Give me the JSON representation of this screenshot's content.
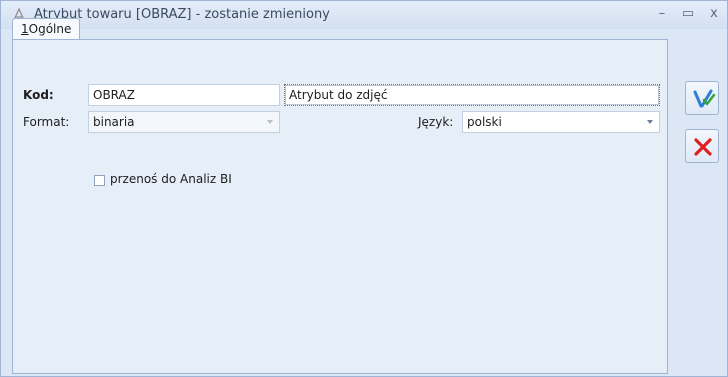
{
  "window": {
    "title": "Atrybut towaru [OBRAZ] - zostanie zmieniony",
    "controls": {
      "minimize": "–",
      "maximize": "▭",
      "close": "x"
    }
  },
  "tabs": [
    {
      "hotkey": "1",
      "label": "Ogólne",
      "active": true
    }
  ],
  "form": {
    "kod": {
      "label": "Kod:",
      "value": "OBRAZ",
      "description": "Atrybut do zdjęć"
    },
    "format": {
      "label": "Format:",
      "value": "binaria",
      "disabled": true
    },
    "jezyk": {
      "label": "Język:",
      "value": "polski"
    },
    "analiz_bi": {
      "label": "przenoś do Analiz BI",
      "checked": false
    }
  },
  "actions": {
    "save": {
      "icon": "save-check-icon"
    },
    "cancel": {
      "icon": "red-x-icon"
    }
  },
  "colors": {
    "window_bg": "#dce7f5",
    "panel_bg": "#e6eef8",
    "border": "#9fb5d3",
    "accent_blue": "#2c7fd6",
    "cancel_red": "#e02020"
  }
}
